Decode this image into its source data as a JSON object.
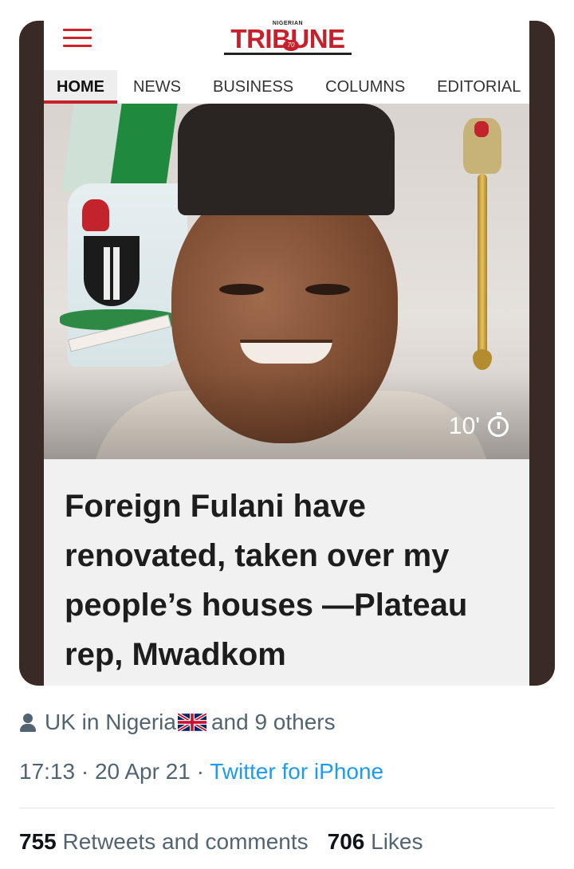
{
  "app": {
    "logo_small": "NIGERIAN",
    "logo_main": "TRIBUNE",
    "logo_badge": "70"
  },
  "nav": {
    "items": [
      {
        "label": "HOME",
        "active": true
      },
      {
        "label": "NEWS",
        "active": false
      },
      {
        "label": "BUSINESS",
        "active": false
      },
      {
        "label": "COLUMNS",
        "active": false
      },
      {
        "label": "EDITORIAL",
        "active": false
      }
    ]
  },
  "article": {
    "read_time": "10'",
    "read_time_icon": "stopwatch-icon",
    "headline": "Foreign Fulani have renovated, taken over my people’s houses —Plateau rep, Mwadkom"
  },
  "tweet": {
    "liked_by_icon": "person-icon",
    "liked_by_name": "UK in Nigeria",
    "liked_by_flag": "uk-flag-icon",
    "liked_by_suffix": "and 9 others",
    "time": "17:13",
    "separator": "·",
    "date": "20 Apr 21",
    "source": "Twitter for iPhone",
    "retweets_count": "755",
    "retweets_label": "Retweets and comments",
    "likes_count": "706",
    "likes_label": "Likes"
  },
  "colors": {
    "accent_red": "#c8202a",
    "link_blue": "#1d9bf0",
    "frame": "#3a2a26",
    "meta_gray": "#536471"
  }
}
